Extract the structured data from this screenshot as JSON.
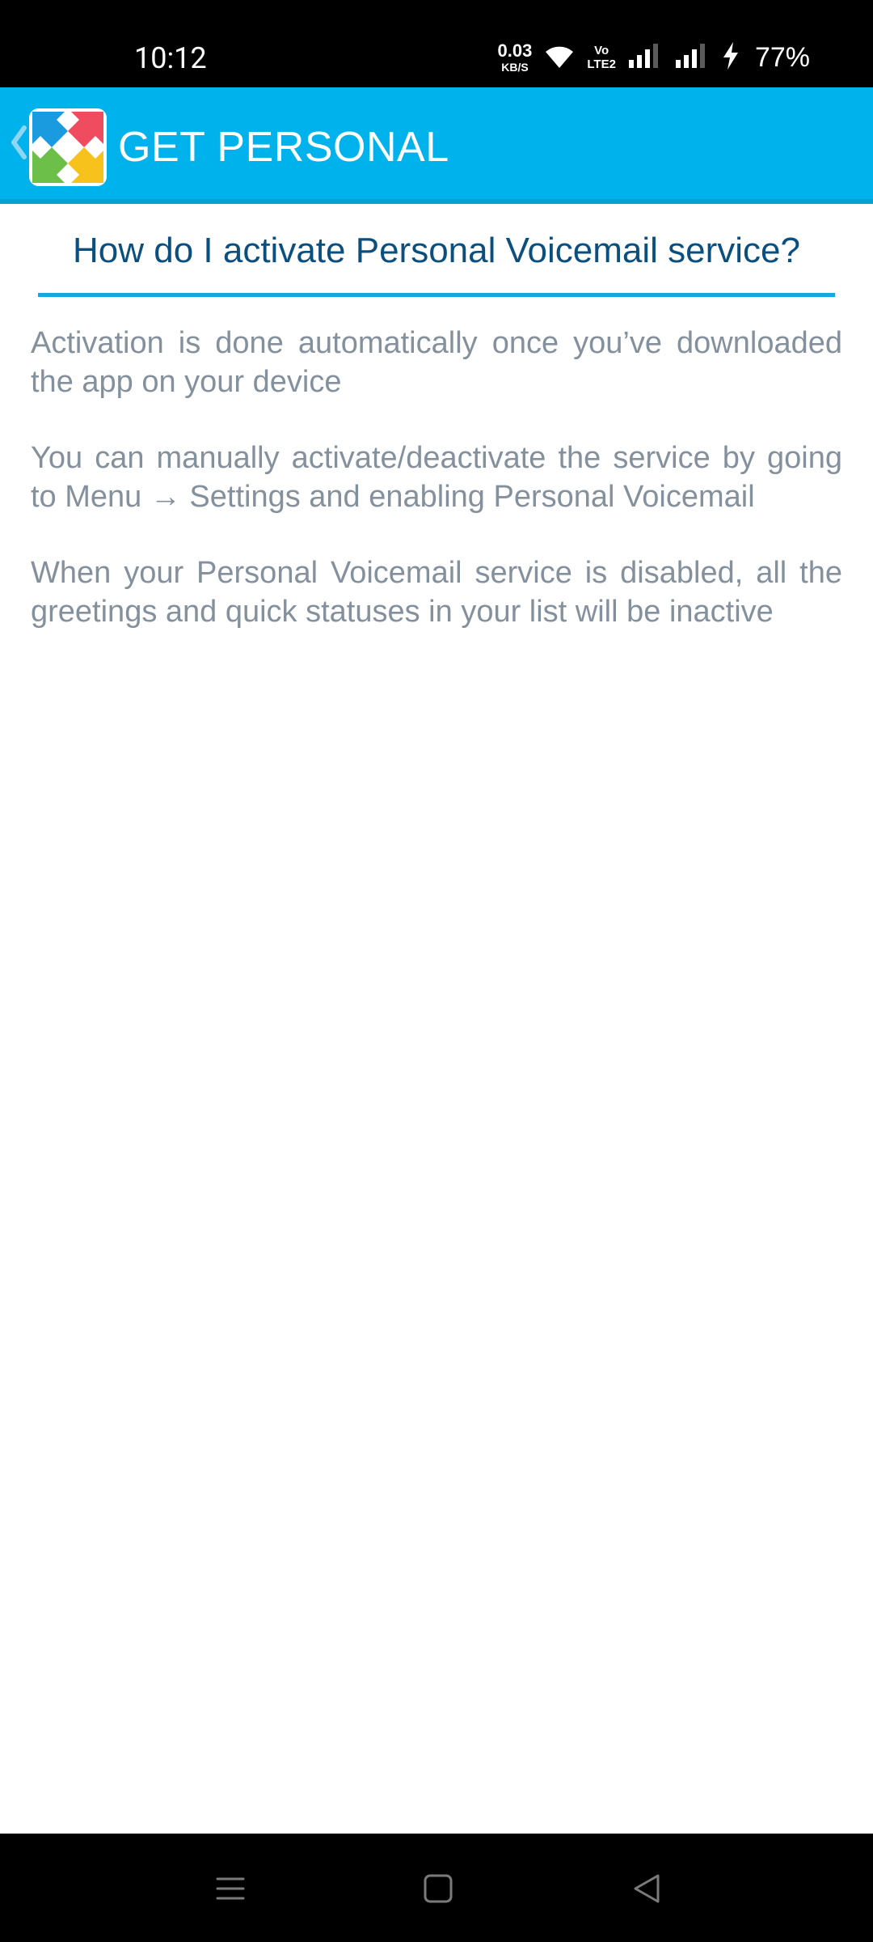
{
  "status_bar": {
    "time": "10:12",
    "net_speed_value": "0.03",
    "net_speed_unit": "KB/S",
    "volte_top": "Vo",
    "volte_bottom": "LTE2",
    "battery_percent": "77%",
    "icons": [
      "wifi-icon",
      "signal-icon",
      "signal-icon",
      "charging-icon"
    ]
  },
  "app_bar": {
    "title": "GET PERSONAL",
    "back_icon": "chevron-left-icon",
    "logo_icon": "app-logo-icon",
    "colors": {
      "background": "#00b2ec",
      "underline": "#0a9fd3"
    }
  },
  "faq": {
    "question": "How do I activate Personal Voicemail service?",
    "paragraphs": [
      "Activation is done automatically once you’ve downloaded the app on your device",
      "You can manually activate/deactivate the service by going to Menu → Settings and enabling Personal Voicemail",
      "When your Personal Voicemail service is disabled, all the greetings and quick statuses in your list will be inactive"
    ],
    "colors": {
      "question": "#0b4f7f",
      "rule": "#13a8e0",
      "body": "#84909c"
    }
  },
  "nav_bar": {
    "icons": [
      "menu-icon",
      "home-icon",
      "back-icon"
    ]
  }
}
